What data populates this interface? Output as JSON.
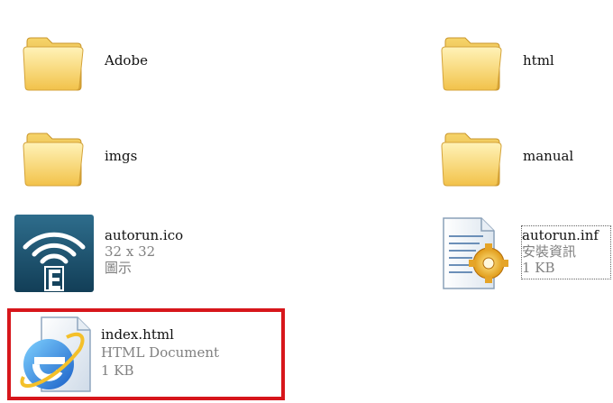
{
  "files": [
    {
      "name": "Adobe",
      "icon": "folder-icon"
    },
    {
      "name": "html",
      "icon": "folder-icon"
    },
    {
      "name": "imgs",
      "icon": "folder-icon"
    },
    {
      "name": "manual",
      "icon": "folder-icon"
    },
    {
      "name": "autorun.ico",
      "line2": "32 x 32",
      "line3": "圖示",
      "icon": "wireless-e-icon"
    },
    {
      "name": "autorun.inf",
      "line2": "安裝資訊",
      "line3": "1 KB",
      "icon": "setup-info-icon"
    },
    {
      "name": "index.html",
      "line2": "HTML Document",
      "line3": "1 KB",
      "icon": "internet-explorer-icon",
      "highlight_color": "#d7161b"
    }
  ]
}
